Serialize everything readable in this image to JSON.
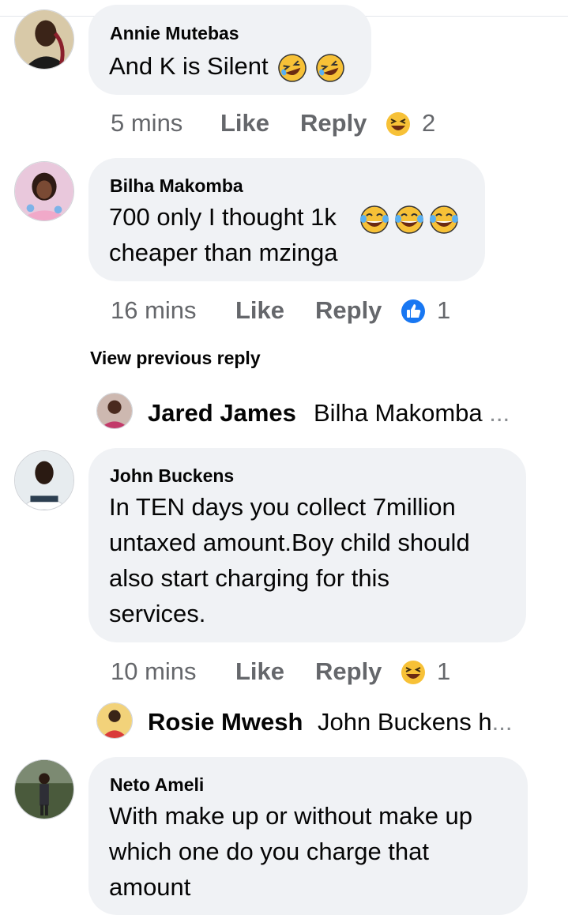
{
  "comments": [
    {
      "author": "Annie Mutebas",
      "lines": [
        "And K is Silent"
      ],
      "emoji_after_text": [
        "rolling-laughing-emoji",
        "rolling-laughing-emoji"
      ],
      "time": "5 mins",
      "like_label": "Like",
      "reply_label": "Reply",
      "reaction_icon": "haha-reaction-icon",
      "reaction_count": "2"
    },
    {
      "author": "Bilha Makomba",
      "lines": [
        "700 only I thought 1k",
        "cheaper than mzinga"
      ],
      "emoji_after_text": [
        "tears-of-joy-emoji",
        "tears-of-joy-emoji",
        "tears-of-joy-emoji"
      ],
      "time": "16 mins",
      "like_label": "Like",
      "reply_label": "Reply",
      "reaction_icon": "like-reaction-icon",
      "reaction_count": "1"
    },
    {
      "author": "John Buckens",
      "lines": [
        "In TEN days you collect 7million",
        "untaxed amount.Boy child should",
        "also start charging for this",
        "services."
      ],
      "time": "10 mins",
      "like_label": "Like",
      "reply_label": "Reply",
      "reaction_icon": "haha-reaction-icon",
      "reaction_count": "1"
    },
    {
      "author": "Neto Ameli",
      "lines": [
        "With make up or without make up",
        "which one do you charge that",
        "amount"
      ]
    }
  ],
  "view_previous_reply": "View previous reply",
  "replies": [
    {
      "name": "Jared James",
      "text": "Bilha Makomba",
      "ellipsis": "..."
    },
    {
      "name": "Rosie Mwesh",
      "text": "John Buckens h",
      "ellipsis": "..."
    }
  ],
  "colors": {
    "bubble": "#f0f2f5",
    "meta_text": "#65676b",
    "like_blue": "#1877f2",
    "emoji_yellow": "#f7c137"
  }
}
